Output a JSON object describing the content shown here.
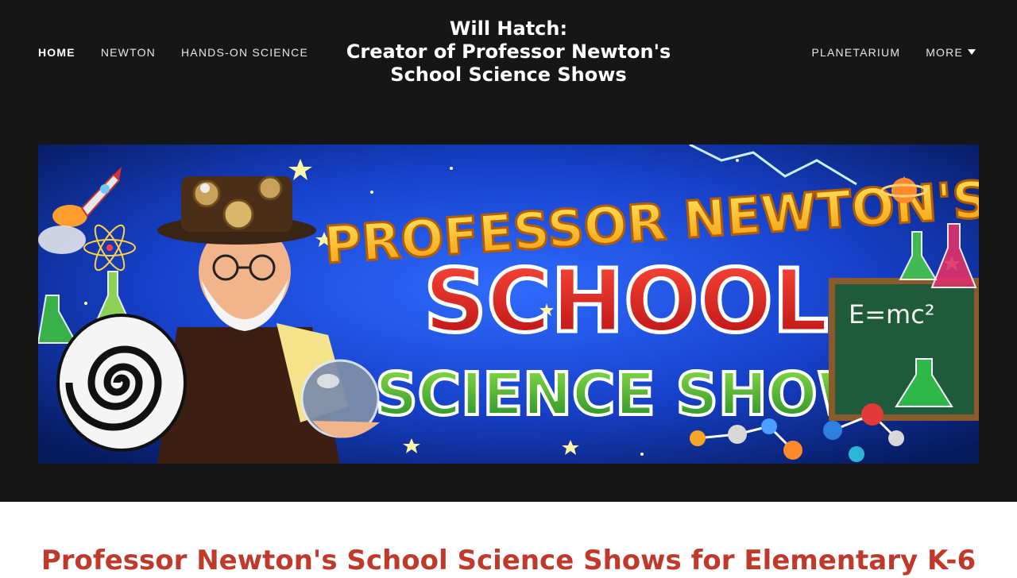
{
  "nav": {
    "left": [
      {
        "label": "HOME",
        "active": true
      },
      {
        "label": "NEWTON",
        "active": false
      },
      {
        "label": "HANDS-ON SCIENCE",
        "active": false
      }
    ],
    "right": [
      {
        "label": "PLANETARIUM"
      },
      {
        "label": "MORE"
      }
    ]
  },
  "site_title": {
    "line1": "Will Hatch:",
    "line2": "Creator of Professor Newton's",
    "line3": "School Science Shows"
  },
  "hero": {
    "banner_line1": "PROFESSOR NEWTON'S",
    "banner_line2": "SCHOOL",
    "banner_line3": "SCIENCE SHOWS",
    "chalkboard_text": "E=mc²"
  },
  "main": {
    "heading": "Professor Newton's School Science Shows for Elementary K-6"
  },
  "colors": {
    "header_bg": "#161616",
    "heading": "#c0392b",
    "banner_yellow": "#f7c21b",
    "banner_red": "#e02121",
    "banner_green": "#3aa53a"
  }
}
